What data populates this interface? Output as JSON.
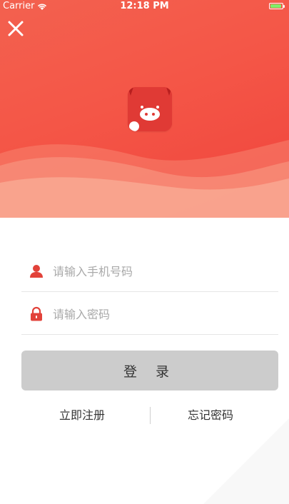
{
  "status_bar": {
    "carrier": "Carrier",
    "time": "12:18 PM",
    "battery_level": 0.95,
    "icons": [
      "wifi-icon",
      "battery-icon"
    ]
  },
  "header": {
    "close_icon": "close-icon",
    "logo_icon": "pig-logo-icon"
  },
  "form": {
    "phone": {
      "placeholder": "请输入手机号码",
      "value": "",
      "icon": "user-icon"
    },
    "password": {
      "placeholder": "请输入密码",
      "value": "",
      "icon": "lock-icon"
    },
    "login_label": "登 录"
  },
  "links": {
    "register": "立即注册",
    "forgot": "忘记密码"
  },
  "colors": {
    "brand_red": "#f45647",
    "icon_red": "#e2423a",
    "button_gray": "#cccccc"
  }
}
